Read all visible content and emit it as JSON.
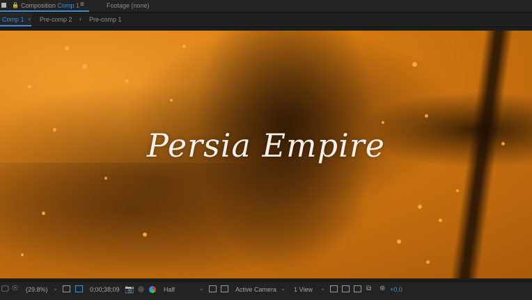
{
  "header": {
    "tab_prefix": "Composition",
    "tab_active_comp": "Comp 1",
    "footage": "Footage  (none)",
    "menu_icon": "hamburger-icon"
  },
  "breadcrumbs": [
    {
      "label": "Comp 1",
      "active": true
    },
    {
      "label": "Pre-comp 2",
      "active": false
    },
    {
      "label": "Pre-comp 1",
      "active": false
    }
  ],
  "viewer": {
    "title_text": "Persia Empire"
  },
  "toolbar": {
    "zoom": "(29.8%)",
    "timecode": "0;00;38;09",
    "resolution": "Half",
    "camera": "Active Camera",
    "views": "1 View",
    "exposure": "+0.0"
  },
  "colors": {
    "accent": "#3f8fd8",
    "panel": "#232323",
    "image_orange": "#e08a1c"
  }
}
